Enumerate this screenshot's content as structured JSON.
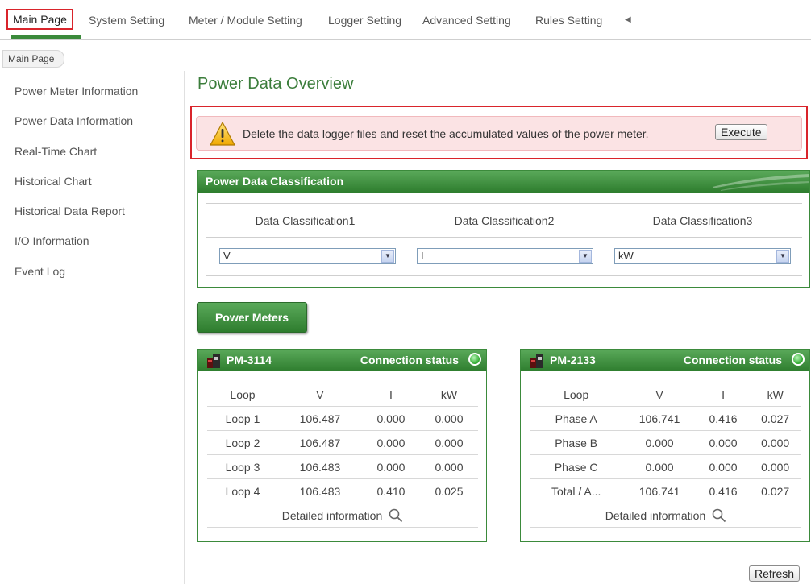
{
  "nav": {
    "tabs": [
      "Main Page",
      "System Setting",
      "Meter / Module Setting",
      "Logger Setting",
      "Advanced Setting",
      "Rules Setting"
    ],
    "active": "Main Page",
    "scroll_icon": "triangle-left-icon"
  },
  "breadcrumb": "Main Page",
  "sidebar": {
    "items": [
      "Power Meter Information",
      "Power Data Information",
      "Real-Time Chart",
      "Historical Chart",
      "Historical Data Report",
      "I/O Information",
      "Event Log"
    ]
  },
  "title": "Power Data Overview",
  "warning": {
    "icon": "warning-icon",
    "message": "Delete the data logger files and reset the accumulated values of the power meter.",
    "button": "Execute"
  },
  "classification": {
    "header": "Power Data Classification",
    "columns": [
      {
        "label": "Data Classification1",
        "value": "V"
      },
      {
        "label": "Data Classification2",
        "value": "I"
      },
      {
        "label": "Data Classification3",
        "value": "kW"
      }
    ]
  },
  "power_meters_button": "Power Meters",
  "meters": [
    {
      "name": "PM-3114",
      "status_label": "Connection status",
      "status_color": "#2ea82e",
      "columns": [
        "Loop",
        "V",
        "I",
        "kW"
      ],
      "rows": [
        [
          "Loop 1",
          "106.487",
          "0.000",
          "0.000"
        ],
        [
          "Loop 2",
          "106.487",
          "0.000",
          "0.000"
        ],
        [
          "Loop 3",
          "106.483",
          "0.000",
          "0.000"
        ],
        [
          "Loop 4",
          "106.483",
          "0.410",
          "0.025"
        ]
      ],
      "detail": "Detailed information"
    },
    {
      "name": "PM-2133",
      "status_label": "Connection status",
      "status_color": "#2ea82e",
      "columns": [
        "Loop",
        "V",
        "I",
        "kW"
      ],
      "rows": [
        [
          "Phase A",
          "106.741",
          "0.416",
          "0.027"
        ],
        [
          "Phase B",
          "0.000",
          "0.000",
          "0.000"
        ],
        [
          "Phase C",
          "0.000",
          "0.000",
          "0.000"
        ],
        [
          "Total / A...",
          "106.741",
          "0.416",
          "0.027"
        ]
      ],
      "detail": "Detailed information"
    }
  ],
  "refresh_button": "Refresh",
  "colors": {
    "accent_green": "#3b8a3b",
    "highlight_red": "#d9242b",
    "warning_bg": "#fbe3e4"
  }
}
